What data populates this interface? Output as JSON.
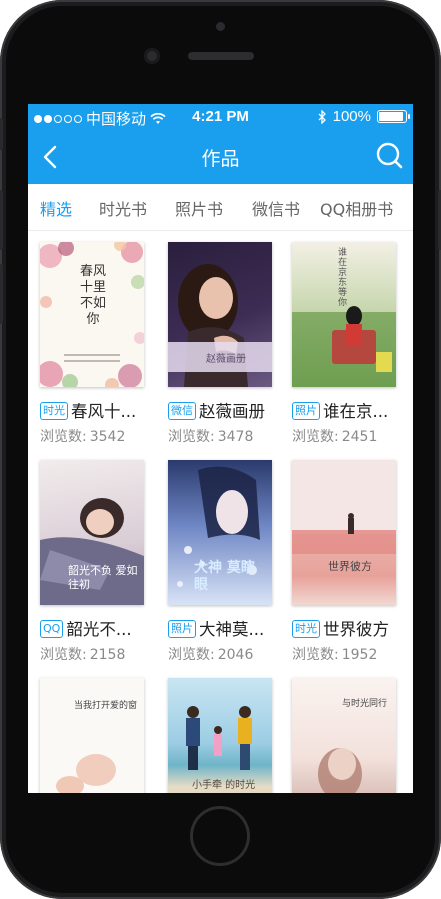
{
  "status_bar": {
    "carrier": "中国移动",
    "time": "4:21 PM",
    "battery": "100%",
    "battery_level": 1.0
  },
  "nav": {
    "title": "作品"
  },
  "tabs": [
    {
      "label": "精选",
      "active": true
    },
    {
      "label": "时光书",
      "active": false
    },
    {
      "label": "照片书",
      "active": false
    },
    {
      "label": "微信书",
      "active": false
    },
    {
      "label": "QQ相册书",
      "active": false
    }
  ],
  "views_label": "浏览数:",
  "books": [
    {
      "badge": "时光",
      "title": "春风十...",
      "views": "3542",
      "cover_text": "春风十里不如你"
    },
    {
      "badge": "微信",
      "title": "赵薇画册",
      "views": "3478",
      "cover_text": "赵薇画册"
    },
    {
      "badge": "照片",
      "title": "谁在京...",
      "views": "2451",
      "cover_text": "谁在京东等你"
    },
    {
      "badge": "QQ",
      "title": "韶光不...",
      "views": "2158",
      "cover_text": "韶光不负 爱如往初"
    },
    {
      "badge": "照片",
      "title": "大神莫...",
      "views": "2046",
      "cover_text": "大神 莫瞎眼"
    },
    {
      "badge": "时光",
      "title": "世界彼方",
      "views": "1952",
      "cover_text": "世界彼方"
    },
    {
      "cover_text": "当我打开爱的窗"
    },
    {
      "cover_text": "小手牵 的时光"
    },
    {
      "cover_text": "与时光同行"
    }
  ],
  "colors": {
    "accent": "#1a9fee",
    "text": "#222222",
    "muted": "#8a8a8a"
  }
}
